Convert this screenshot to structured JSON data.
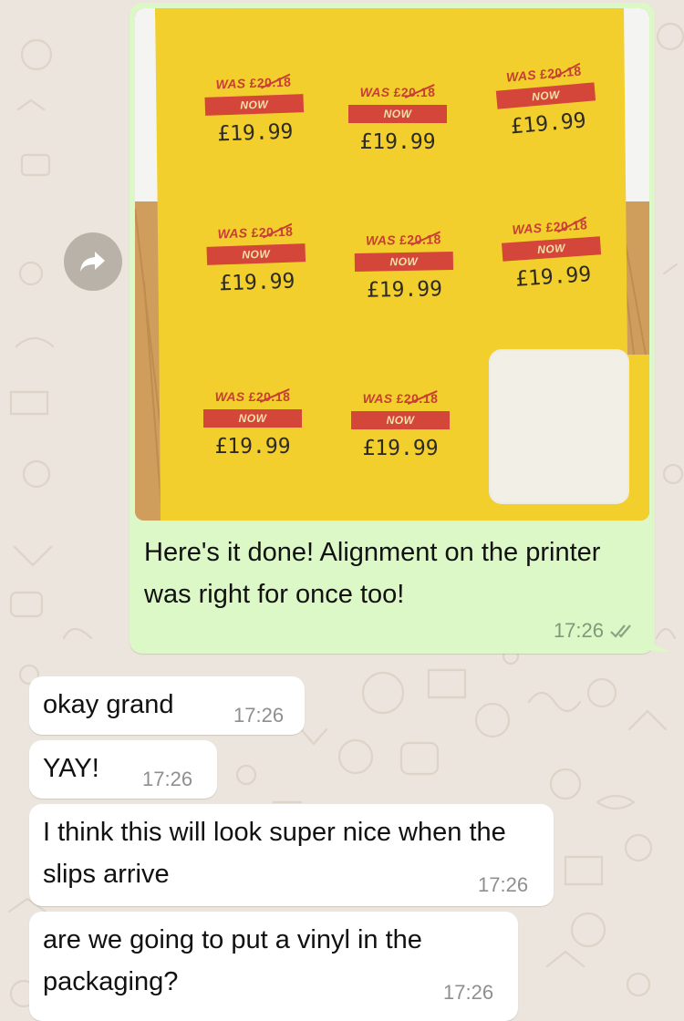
{
  "outgoing": {
    "image": {
      "labels": [
        {
          "was": "WAS",
          "old_price": "£20.18",
          "now": "NOW",
          "price": "£19.99"
        },
        {
          "was": "WAS",
          "old_price": "£20.18",
          "now": "NOW",
          "price": "£19.99"
        },
        {
          "was": "WAS",
          "old_price": "£20.18",
          "now": "NOW",
          "price": "£19.99"
        },
        {
          "was": "WAS",
          "old_price": "£20.18",
          "now": "NOW",
          "price": "£19.99"
        },
        {
          "was": "WAS",
          "old_price": "£20.18",
          "now": "NOW",
          "price": "£19.99"
        },
        {
          "was": "WAS",
          "old_price": "£20.18",
          "now": "NOW",
          "price": "£19.99"
        },
        {
          "was": "WAS",
          "old_price": "£20.18",
          "now": "NOW",
          "price": "£19.99"
        },
        {
          "was": "WAS",
          "old_price": "£20.18",
          "now": "NOW",
          "price": "£19.99"
        }
      ]
    },
    "text": "Here's it done! Alignment on the printer was right for once too!",
    "time": "17:26",
    "status_icon": "double-check-icon"
  },
  "incoming": [
    {
      "text": "okay grand",
      "time": "17:26"
    },
    {
      "text": "YAY!",
      "time": "17:26"
    },
    {
      "text": "I think this will look super nice when the slips arrive",
      "time": "17:26"
    },
    {
      "text": "are we going to put a vinyl in the packaging?",
      "time": "17:26"
    }
  ],
  "colors": {
    "chat_background": "#ece5dd",
    "outgoing_bubble": "#dcf8c6",
    "incoming_bubble": "#ffffff",
    "label_sheet": "#f3cf2e",
    "now_bar": "#d4463a"
  }
}
